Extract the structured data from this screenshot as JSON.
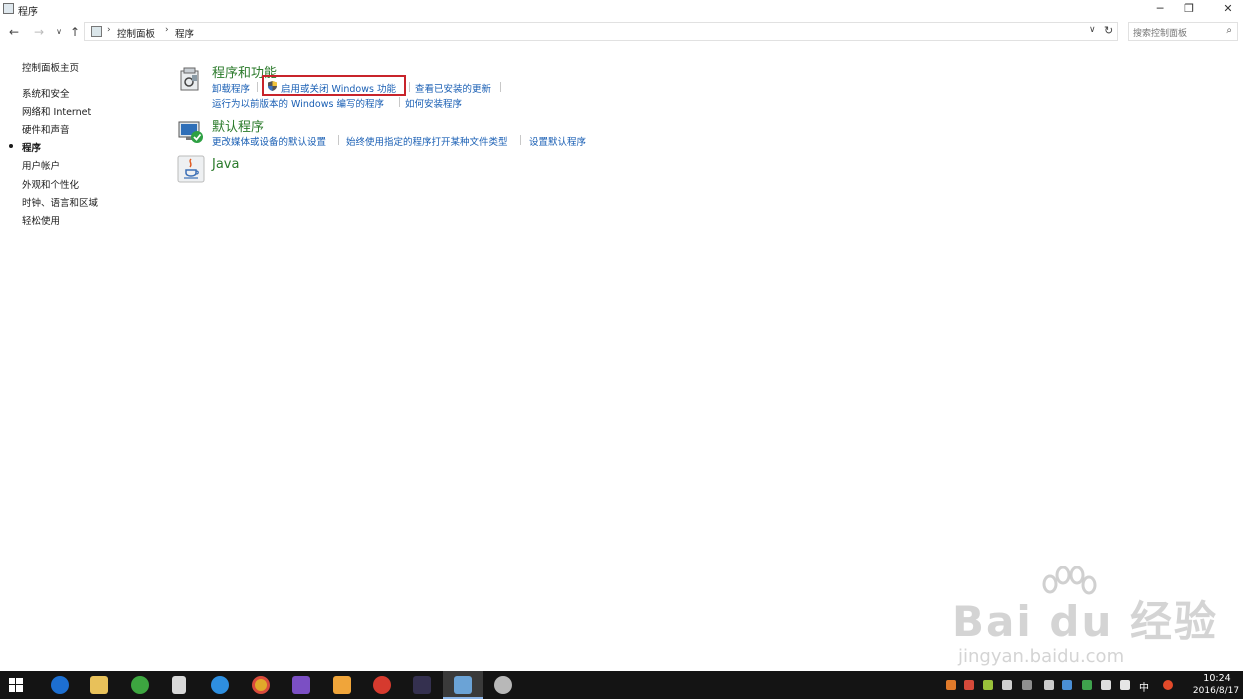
{
  "window": {
    "title": "程序",
    "minimize_glyph": "─",
    "restore_glyph": "❐",
    "close_glyph": "✕"
  },
  "nav": {
    "back_glyph": "←",
    "forward_glyph": "→",
    "recent_glyph": "∨",
    "up_glyph": "↑",
    "breadcrumb": [
      "控制面板",
      "程序"
    ],
    "crumb_separator": "›",
    "dropdown_glyph": "∨",
    "refresh_glyph": "↻",
    "search_placeholder": "搜索控制面板",
    "search_glyph": "⌕"
  },
  "sidebar": {
    "items": [
      {
        "label": "控制面板主页"
      },
      {
        "label": "系统和安全"
      },
      {
        "label": "网络和 Internet"
      },
      {
        "label": "硬件和声音"
      },
      {
        "label": "程序",
        "selected": true
      },
      {
        "label": "用户帐户"
      },
      {
        "label": "外观和个性化"
      },
      {
        "label": "时钟、语言和区域"
      },
      {
        "label": "轻松使用"
      }
    ]
  },
  "categories": {
    "programs_features": {
      "title": "程序和功能",
      "icon": "programs-features-icon",
      "links": [
        "卸载程序",
        "启用或关闭 Windows 功能",
        "查看已安装的更新",
        "运行为以前版本的 Windows 编写的程序",
        "如何安装程序"
      ]
    },
    "default_programs": {
      "title": "默认程序",
      "icon": "default-programs-icon",
      "links": [
        "更改媒体或设备的默认设置",
        "始终使用指定的程序打开某种文件类型",
        "设置默认程序"
      ]
    },
    "java": {
      "title": "Java",
      "icon": "java-icon"
    }
  },
  "highlight_color": "#c8242b",
  "link_color": "#1a5fb4",
  "category_title_color": "#2a7a2a",
  "watermark": {
    "logo": "Bai du 经验",
    "url": "jingyan.baidu.com"
  },
  "taskbar": {
    "pinned": [
      "windows-start-icon",
      "edge-icon",
      "file-explorer-icon",
      "app-green-icon",
      "calculator-icon",
      "ie-icon",
      "chrome-icon",
      "visual-studio-icon",
      "app-orange-icon",
      "app-red-icon",
      "app-dark-icon",
      "control-panel-icon",
      "app-gray-icon"
    ],
    "ime_label": "中",
    "clock_time": "10:24",
    "clock_date": "2016/8/17"
  }
}
